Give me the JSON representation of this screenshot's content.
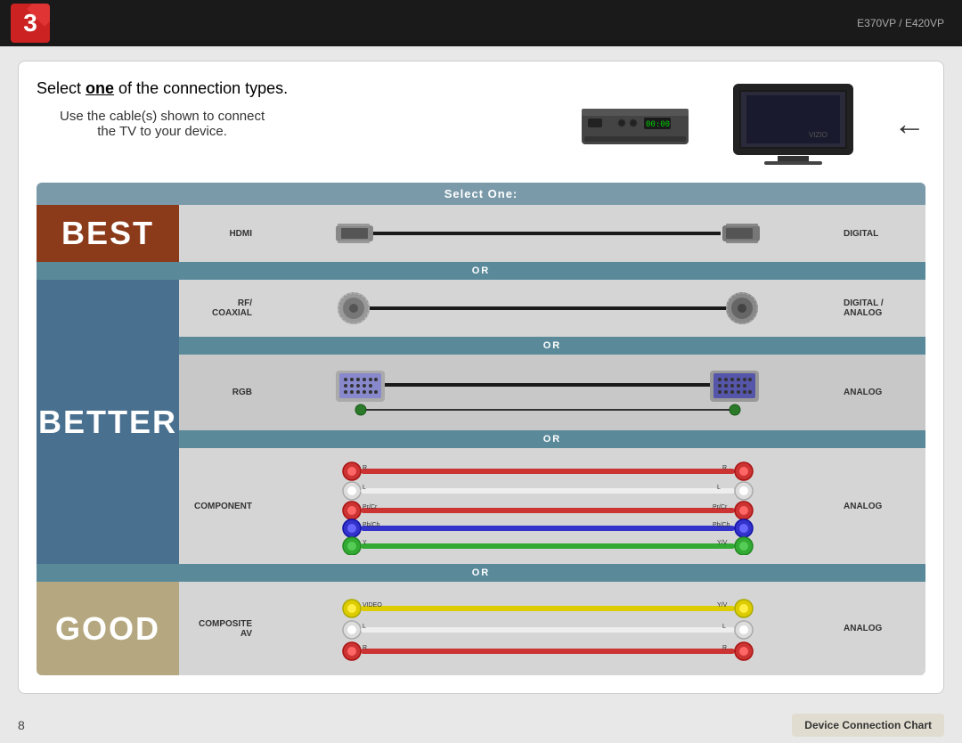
{
  "header": {
    "step_number": "3",
    "model": "E370VP / E420VP"
  },
  "intro": {
    "line1": "Select ",
    "underline": "one",
    "line1_end": " of the connection types.",
    "line2": "Use the cable(s) shown to connect",
    "line3": "the TV to your device."
  },
  "select_one_label": "Select One:",
  "quality_labels": {
    "best": "BEST",
    "better": "BETTER",
    "good": "GOOD"
  },
  "connections": {
    "hdmi": {
      "left_label": "HDMI",
      "right_label": "DIGITAL"
    },
    "rf_coaxial": {
      "left_label": "RF/ COAXIAL",
      "right_label": "DIGITAL / ANALOG"
    },
    "rgb": {
      "left_label": "RGB",
      "right_label": "ANALOG"
    },
    "component": {
      "left_label": "COMPONENT",
      "right_label": "ANALOG"
    },
    "composite_av": {
      "left_label": "COMPOSITE AV",
      "right_label": "ANALOG"
    }
  },
  "or_label": "OR",
  "footer": {
    "page_number": "8",
    "chart_label": "Device Connection Chart"
  }
}
